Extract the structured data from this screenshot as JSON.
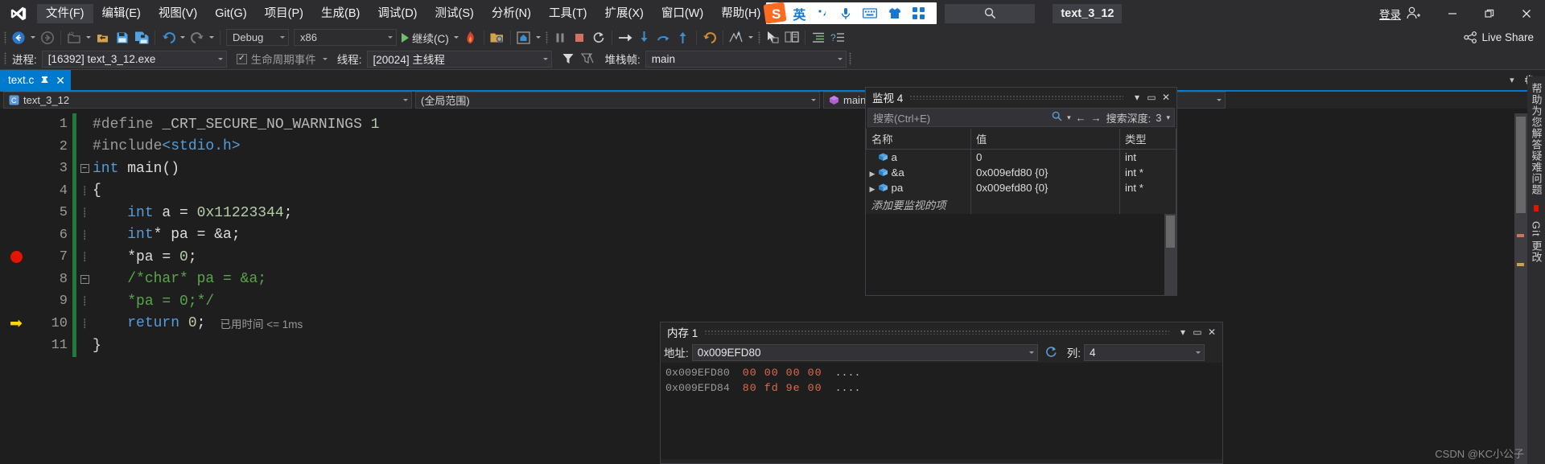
{
  "window": {
    "solution_name": "text_3_12",
    "sign_in_label": "登录",
    "minimize_label": "—",
    "restore_label": "❐",
    "close_label": "✕"
  },
  "menu": {
    "items": [
      {
        "label": "文件(F)",
        "active": true
      },
      {
        "label": "编辑(E)",
        "active": false
      },
      {
        "label": "视图(V)",
        "active": false
      },
      {
        "label": "Git(G)",
        "active": false
      },
      {
        "label": "项目(P)",
        "active": false
      },
      {
        "label": "生成(B)",
        "active": false
      },
      {
        "label": "调试(D)",
        "active": false
      },
      {
        "label": "测试(S)",
        "active": false
      },
      {
        "label": "分析(N)",
        "active": false
      },
      {
        "label": "工具(T)",
        "active": false
      },
      {
        "label": "扩展(X)",
        "active": false
      },
      {
        "label": "窗口(W)",
        "active": false
      },
      {
        "label": "帮助(H)",
        "active": false
      }
    ]
  },
  "ime": {
    "logo": "sogou-logo-icon",
    "mode": "英",
    "icons": [
      "punctuation-icon",
      "microphone-icon",
      "keyboard-icon",
      "skin-icon",
      "toolbox-icon"
    ]
  },
  "toolbar": {
    "configuration": "Debug",
    "platform": "x86",
    "continue_label": "继续(C)",
    "live_share_label": "Live Share",
    "icons": [
      "navigate-back-icon",
      "navigate-forward-icon",
      "new-project-icon",
      "open-file-icon",
      "save-icon",
      "save-all-icon",
      "undo-icon",
      "redo-icon",
      "start-debug-icon",
      "hot-reload-icon",
      "attach-process-icon",
      "screenshot-icon",
      "break-all-icon",
      "stop-debugging-icon",
      "restart-icon",
      "show-next-statement-icon",
      "step-into-icon",
      "step-over-icon",
      "step-out-icon",
      "step-back-icon",
      "diagnostics-icon",
      "pointer-icon",
      "compare-icon",
      "indent-icon",
      "comment-icon"
    ]
  },
  "process_bar": {
    "process_label": "进程:",
    "process_value": "[16392] text_3_12.exe",
    "lifecycle_label": "生命周期事件",
    "thread_label": "线程:",
    "thread_value": "[20024] 主线程",
    "stackframe_label": "堆栈帧:",
    "stackframe_value": "main"
  },
  "editor": {
    "tab": {
      "label": "text.c",
      "pin_icon": "pin-icon",
      "close_icon": "close-icon"
    },
    "nav": {
      "file_selector": "text_3_12",
      "scope_selector": "(全局范围)",
      "member_selector": "main()"
    },
    "elapsed_tip": "已用时间 <= 1ms",
    "lines": [
      {
        "num": "1",
        "marker": "none",
        "fold": "none",
        "changed": true,
        "tokens": [
          {
            "t": "pre",
            "v": "#define"
          },
          {
            "t": "plain",
            "v": " "
          },
          {
            "t": "macro",
            "v": "_CRT_SECURE_NO_WARNINGS"
          },
          {
            "t": "plain",
            "v": " "
          },
          {
            "t": "num",
            "v": "1"
          }
        ]
      },
      {
        "num": "2",
        "marker": "none",
        "fold": "none",
        "changed": true,
        "tokens": [
          {
            "t": "pre",
            "v": "#include"
          },
          {
            "t": "kw",
            "v": "<stdio.h>"
          }
        ]
      },
      {
        "num": "3",
        "marker": "none",
        "fold": "collapse",
        "changed": true,
        "tokens": [
          {
            "t": "kw",
            "v": "int"
          },
          {
            "t": "plain",
            "v": " "
          },
          {
            "t": "id",
            "v": "main"
          },
          {
            "t": "plain",
            "v": "()"
          }
        ]
      },
      {
        "num": "4",
        "marker": "none",
        "fold": "none",
        "changed": true,
        "tokens": [
          {
            "t": "plain",
            "v": "{"
          }
        ]
      },
      {
        "num": "5",
        "marker": "none",
        "fold": "none",
        "changed": true,
        "tokens": [
          {
            "t": "plain",
            "v": "    "
          },
          {
            "t": "kw",
            "v": "int"
          },
          {
            "t": "plain",
            "v": " a = "
          },
          {
            "t": "num",
            "v": "0x11223344"
          },
          {
            "t": "plain",
            "v": ";"
          }
        ]
      },
      {
        "num": "6",
        "marker": "none",
        "fold": "none",
        "changed": true,
        "tokens": [
          {
            "t": "plain",
            "v": "    "
          },
          {
            "t": "kw",
            "v": "int"
          },
          {
            "t": "plain",
            "v": "* pa = &a;"
          }
        ]
      },
      {
        "num": "7",
        "marker": "breakpoint",
        "fold": "none",
        "changed": true,
        "tokens": [
          {
            "t": "plain",
            "v": "    *pa = "
          },
          {
            "t": "num",
            "v": "0"
          },
          {
            "t": "plain",
            "v": ";"
          }
        ]
      },
      {
        "num": "8",
        "marker": "none",
        "fold": "collapse",
        "changed": true,
        "tokens": [
          {
            "t": "plain",
            "v": "    "
          },
          {
            "t": "cmt",
            "v": "/*char* pa = &a;"
          }
        ]
      },
      {
        "num": "9",
        "marker": "none",
        "fold": "none",
        "changed": true,
        "tokens": [
          {
            "t": "plain",
            "v": "    "
          },
          {
            "t": "cmt",
            "v": "*pa = 0;*/"
          }
        ]
      },
      {
        "num": "10",
        "marker": "current",
        "fold": "none",
        "changed": true,
        "tokens": [
          {
            "t": "plain",
            "v": "    "
          },
          {
            "t": "kw",
            "v": "return"
          },
          {
            "t": "plain",
            "v": " "
          },
          {
            "t": "num",
            "v": "0"
          },
          {
            "t": "plain",
            "v": ";"
          }
        ]
      },
      {
        "num": "11",
        "marker": "none",
        "fold": "none",
        "changed": true,
        "tokens": [
          {
            "t": "plain",
            "v": "}"
          }
        ]
      }
    ]
  },
  "watch": {
    "title": "监视 4",
    "search_placeholder": "搜索(Ctrl+E)",
    "search_depth_label": "搜索深度:",
    "search_depth_value": "3",
    "columns": [
      "名称",
      "值",
      "类型"
    ],
    "rows": [
      {
        "expander": "",
        "name": "a",
        "value": "0",
        "value_changed": false,
        "type": "int"
      },
      {
        "expander": "▶",
        "name": "&a",
        "value": "0x009efd80 {0}",
        "value_changed": true,
        "type": "int *"
      },
      {
        "expander": "▶",
        "name": "pa",
        "value": "0x009efd80 {0}",
        "value_changed": true,
        "type": "int *"
      }
    ],
    "add_row_placeholder": "添加要监视的项"
  },
  "memory": {
    "title": "内存 1",
    "address_label": "地址:",
    "address_value": "0x009EFD80",
    "columns_label": "列:",
    "columns_value": "4",
    "refresh_icon": "refresh-icon",
    "lines": [
      {
        "address": "0x009EFD80",
        "hex": "00 00 00 00",
        "ascii": "...."
      },
      {
        "address": "0x009EFD84",
        "hex": "80 fd 9e 00",
        "ascii": "...."
      }
    ]
  },
  "right_tabs": [
    {
      "label": "帮助为您解答疑难问题"
    },
    {
      "label": "Git 更改"
    }
  ],
  "watermark": "CSDN @KC小公子",
  "colors": {
    "accent": "#007acc",
    "breakpoint": "#e51400",
    "current_line_arrow": "#ffd700",
    "changed_value": "#e06c4b",
    "comment": "#57a64a",
    "keyword": "#569cd6",
    "number": "#b5cea8",
    "titlebar_bg": "#2d2d30",
    "editor_bg": "#1e1e1e"
  }
}
